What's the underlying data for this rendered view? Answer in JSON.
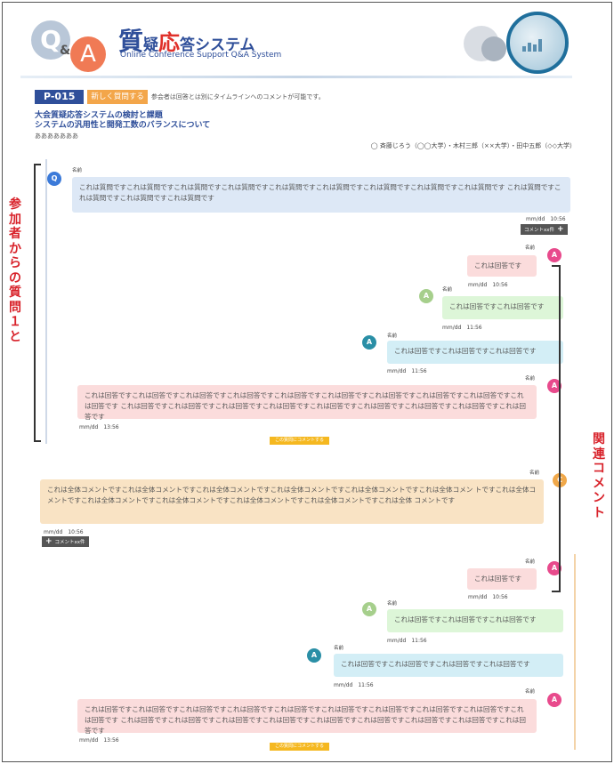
{
  "header": {
    "logo": {
      "q": "Q",
      "amp": "&",
      "a": "A"
    },
    "title_parts": {
      "big": "質",
      "small1": "疑",
      "red": "応",
      "rest": "答システム"
    },
    "subtitle": "Online Conference Support Q&A System"
  },
  "paper": {
    "id": "P-015",
    "new_question_label": "新しく質問する",
    "note": "参会者は回答とは別にタイムラインへのコメントが可能です。",
    "title_line1": "大会質疑応答システムの検討と課題",
    "title_line2": "システムの汎用性と開発工数のバランスについて",
    "extra": "あああああああ",
    "authors": "◯ 斉藤じろう（◯◯大学）・木村三郎（××大学）・田中五郎（◇◇大学）"
  },
  "thread1": {
    "question": {
      "avatar": "Q",
      "name": "名前",
      "text": "これは質問ですこれは質問ですこれは質問ですこれは質問ですこれは質問ですこれは質問ですこれは質問ですこれは質問ですこれは質問です これは質問ですこれは質問ですこれは質問ですこれは質問です",
      "time": "mm/dd　10:56",
      "count_label": "コメントxx件"
    },
    "answers": [
      {
        "avatar": "A",
        "name": "名前",
        "text": "これは回答です",
        "time": "mm/dd　10:56"
      },
      {
        "avatar": "A",
        "name": "名前",
        "text": "これは回答ですこれは回答です",
        "time": "mm/dd　11:56"
      },
      {
        "avatar": "A",
        "name": "名前",
        "text": "これは回答ですこれは回答ですこれは回答です",
        "time": "mm/dd　11:56"
      },
      {
        "avatar": "A",
        "name": "名前",
        "text": "これは回答ですこれは回答ですこれは回答ですこれは回答ですこれは回答ですこれは回答ですこれは回答ですこれは回答ですこれは回答ですこれは回答です これは回答ですこれは回答ですこれは回答ですこれは回答ですこれは回答ですこれは回答ですこれは回答ですこれは回答ですこれは回答です",
        "time": "mm/dd　13:56"
      }
    ],
    "comment_button": "この質問にコメントする"
  },
  "thread2": {
    "comment": {
      "avatar": "C",
      "name": "名前",
      "text": "これは全体コメントですこれは全体コメントですこれは全体コメントですこれは全体コメントですこれは全体コメントですこれは全体コメン トですこれは全体コメントですこれは全体コメントですこれは全体コメントですこれは全体コメントですこれは全体コメントですこれは全体 コメントです",
      "time": "mm/dd　10:56",
      "count_label": "コメントxx件"
    },
    "answers": [
      {
        "avatar": "A",
        "name": "名前",
        "text": "これは回答です",
        "time": "mm/dd　10:56"
      },
      {
        "avatar": "A",
        "name": "名前",
        "text": "これは回答ですこれは回答ですこれは回答です",
        "time": "mm/dd　11:56"
      },
      {
        "avatar": "A",
        "name": "名前",
        "text": "これは回答ですこれは回答ですこれは回答ですこれは回答です",
        "time": "mm/dd　11:56"
      },
      {
        "avatar": "A",
        "name": "名前",
        "text": "これは回答ですこれは回答ですこれは回答ですこれは回答ですこれは回答ですこれは回答ですこれは回答ですこれは回答ですこれは回答ですこれは回答です これは回答ですこれは回答ですこれは回答ですこれは回答ですこれは回答ですこれは回答ですこれは回答ですこれは回答ですこれは回答です",
        "time": "mm/dd　13:56"
      }
    ],
    "comment_button": "この質問にコメントする"
  },
  "annotations": {
    "left": "参加者からの質問１と",
    "right": "関連コメント"
  },
  "colors": {
    "brand": "#2f4f9a",
    "accent_red": "#e0302a",
    "annotation_red": "#d8222a",
    "button_orange": "#f5b820"
  }
}
